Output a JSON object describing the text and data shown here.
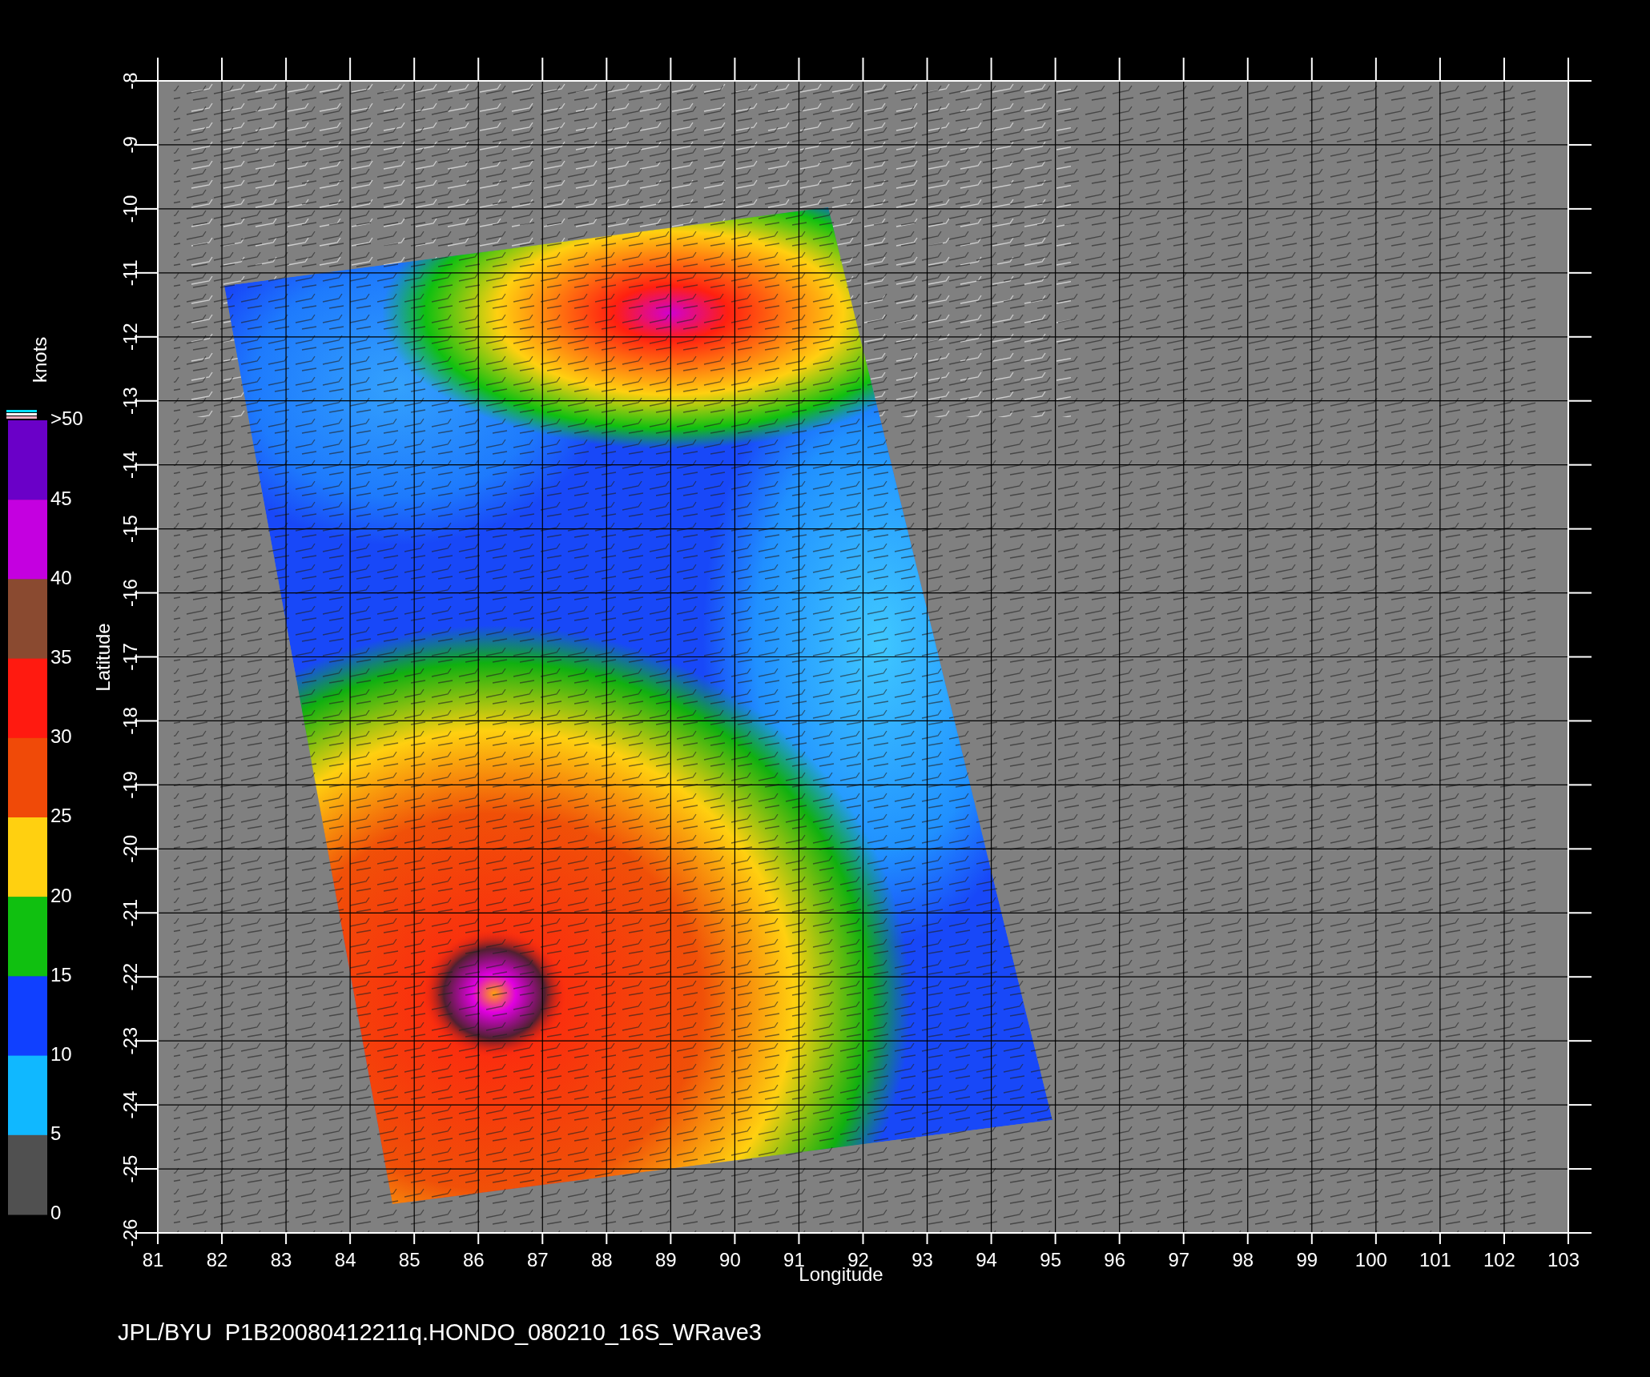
{
  "colorbar": {
    "title": "knots",
    "stops": [
      {
        "label": ">50",
        "color": "#6a00c8"
      },
      {
        "label": "45",
        "color": "#c400e0"
      },
      {
        "label": "40",
        "color": "#8a4a30"
      },
      {
        "label": "35",
        "color": "#ff1a10"
      },
      {
        "label": "30",
        "color": "#f04a08"
      },
      {
        "label": "25",
        "color": "#ffd010"
      },
      {
        "label": "20",
        "color": "#10c010"
      },
      {
        "label": "15",
        "color": "#1040ff"
      },
      {
        "label": "10",
        "color": "#10b8ff"
      },
      {
        "label": "5",
        "color": "#505050"
      },
      {
        "label": "0"
      }
    ]
  },
  "plot": {
    "xlabel": "Longitude",
    "ylabel": "Latitude",
    "yticks": [
      "-8",
      "-9",
      "-10",
      "-11",
      "-12",
      "-13",
      "-14",
      "-15",
      "-16",
      "-17",
      "-18",
      "-19",
      "-20",
      "-21",
      "-22",
      "-23",
      "-24",
      "-25",
      "-26"
    ],
    "xticks": [
      "81",
      "82",
      "83",
      "84",
      "85",
      "86",
      "87",
      "88",
      "89",
      "90",
      "91",
      "92",
      "93",
      "94",
      "95",
      "96",
      "97",
      "98",
      "99",
      "100",
      "101",
      "102",
      "103"
    ]
  },
  "caption": "JPL/BYU  P1B20080412211q.HONDO_080210_16S_WRave3"
}
